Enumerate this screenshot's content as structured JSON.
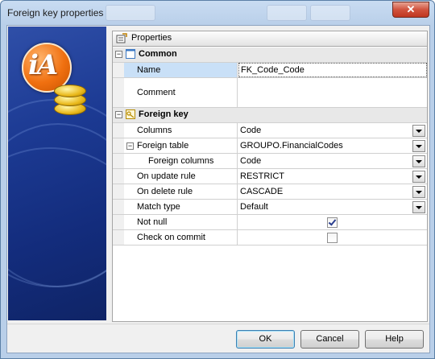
{
  "window": {
    "title": "Foreign key properties",
    "close_glyph": "✕"
  },
  "logo": {
    "text": "iA"
  },
  "properties_panel": {
    "header_label": "Properties",
    "categories": {
      "common": {
        "label": "Common",
        "expander": "−",
        "rows": {
          "name": {
            "label": "Name",
            "value": "FK_Code_Code"
          },
          "comment": {
            "label": "Comment",
            "value": ""
          }
        }
      },
      "foreign_key": {
        "label": "Foreign key",
        "expander": "−",
        "rows": {
          "columns": {
            "label": "Columns",
            "value": "Code"
          },
          "foreign_table": {
            "label": "Foreign table",
            "value": "GROUPO.FinancialCodes",
            "expander": "−"
          },
          "foreign_columns": {
            "label": "Foreign columns",
            "value": "Code"
          },
          "on_update_rule": {
            "label": "On update rule",
            "value": "RESTRICT"
          },
          "on_delete_rule": {
            "label": "On delete rule",
            "value": "CASCADE"
          },
          "match_type": {
            "label": "Match type",
            "value": "Default"
          },
          "not_null": {
            "label": "Not null",
            "checked": true
          },
          "check_on_commit": {
            "label": "Check on commit",
            "checked": false
          }
        }
      }
    }
  },
  "buttons": {
    "ok": "OK",
    "cancel": "Cancel",
    "help": "Help"
  },
  "colors": {
    "accent": "#2f4fa8",
    "selection": "#c9e0f7",
    "logo_orange": "#f07010"
  }
}
